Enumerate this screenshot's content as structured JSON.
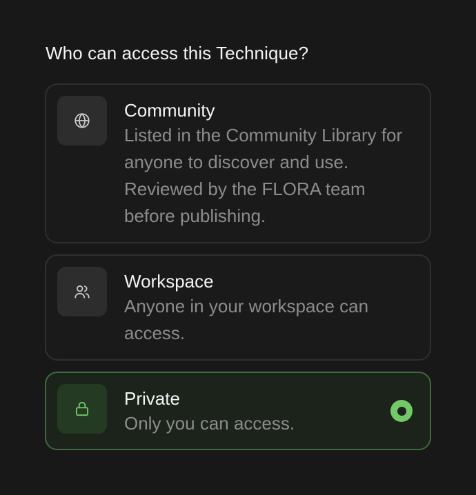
{
  "heading": "Who can access this Technique?",
  "options": [
    {
      "title": "Community",
      "description": "Listed in the Community Library for anyone to discover and use. Reviewed by the FLORA team before publishing.",
      "icon": "globe-icon",
      "selected": false
    },
    {
      "title": "Workspace",
      "description": "Anyone in your workspace can access.",
      "icon": "users-icon",
      "selected": false
    },
    {
      "title": "Private",
      "description": "Only you can access.",
      "icon": "lock-icon",
      "selected": true
    }
  ],
  "colors": {
    "background": "#181818",
    "card_border": "#2f2f2f",
    "selected_border": "#3f6a3c",
    "selected_background": "#1b231b",
    "accent": "#73c86a",
    "muted_text": "#8c8c8c"
  }
}
